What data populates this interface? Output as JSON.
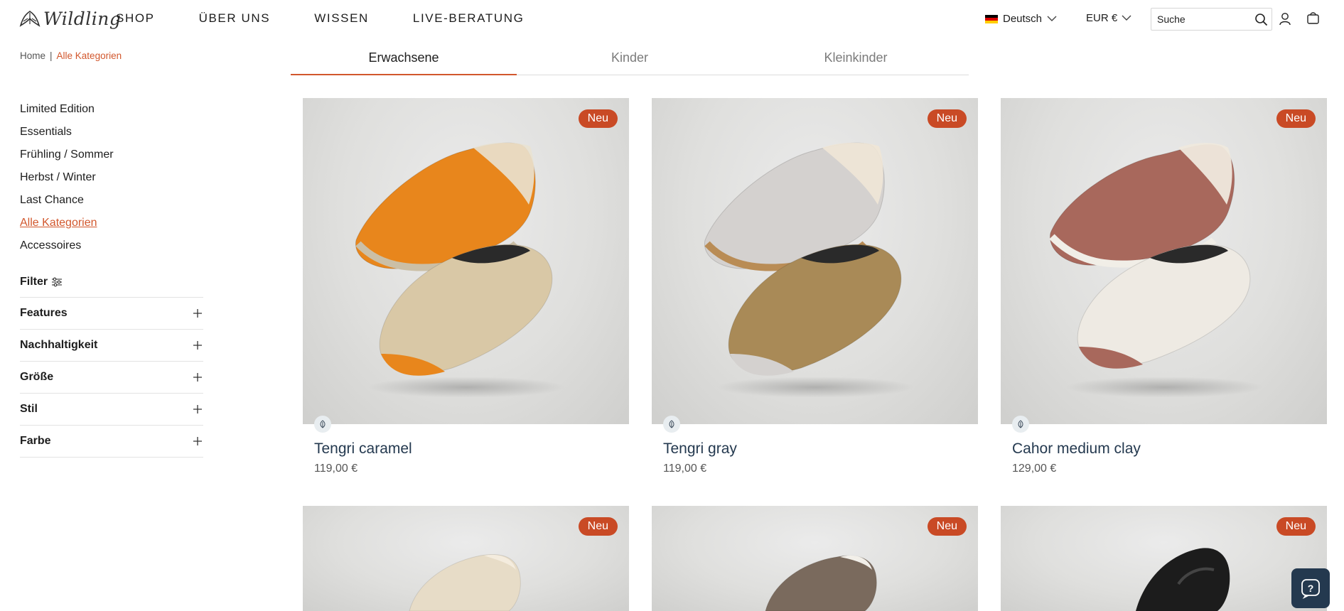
{
  "brand": {
    "name": "Wildling"
  },
  "nav": {
    "items": [
      "SHOP",
      "ÜBER UNS",
      "WISSEN",
      "LIVE-BERATUNG"
    ]
  },
  "header": {
    "language": "Deutsch",
    "currency": "EUR €",
    "search_placeholder": "Suche",
    "icons": [
      "search-icon",
      "user-icon",
      "cart-icon",
      "chevron-down-icon"
    ]
  },
  "breadcrumb": {
    "home": "Home",
    "separator": "|",
    "current": "Alle Kategorien"
  },
  "tabs": [
    "Erwachsene",
    "Kinder",
    "Kleinkinder"
  ],
  "active_tab": "Erwachsene",
  "categories": [
    "Limited Edition",
    "Essentials",
    "Frühling / Sommer",
    "Herbst / Winter",
    "Last Chance",
    "Alle Kategorien",
    "Accessoires"
  ],
  "active_category": "Alle Kategorien",
  "filter": {
    "title": "Filter",
    "facets": [
      "Features",
      "Nachhaltigkeit",
      "Größe",
      "Stil",
      "Farbe"
    ]
  },
  "products": [
    {
      "badge": "Neu",
      "name": "Tengri caramel",
      "price": "119,00 €",
      "color": "#e8861c"
    },
    {
      "badge": "Neu",
      "name": "Tengri gray",
      "price": "119,00 €",
      "color": "#d4d1cf"
    },
    {
      "badge": "Neu",
      "name": "Cahor medium clay",
      "price": "129,00 €",
      "color": "#a8685c"
    },
    {
      "badge": "Neu",
      "name": "",
      "price": "",
      "color": "#e7dcc7"
    },
    {
      "badge": "Neu",
      "name": "",
      "price": "",
      "color": "#7a6a5d"
    },
    {
      "badge": "Neu",
      "name": "",
      "price": "",
      "color": "#1c1c1c"
    }
  ],
  "colors": {
    "accent": "#d2572d",
    "badge": "#c94a25",
    "product_title": "#24394f",
    "help_button": "#24394f"
  }
}
